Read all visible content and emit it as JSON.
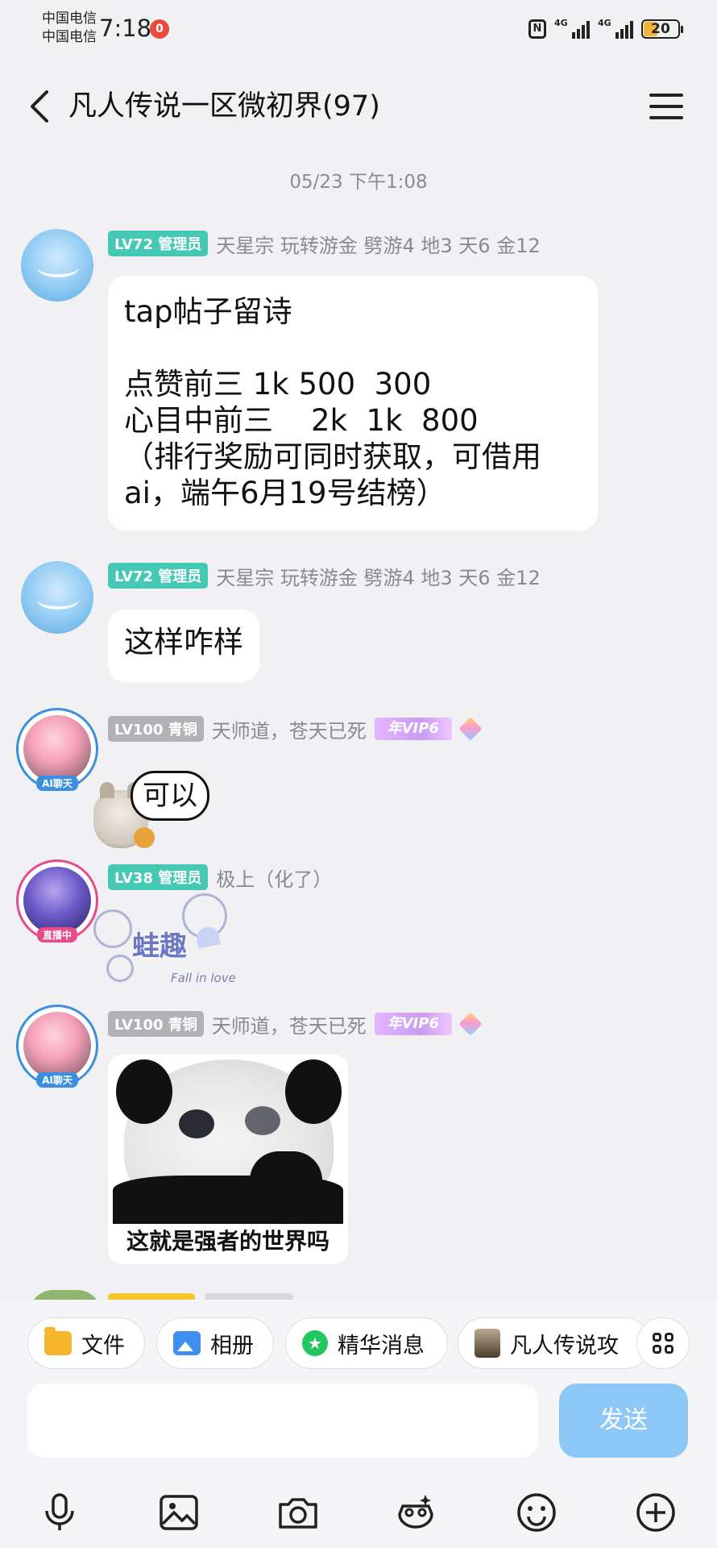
{
  "status_bar": {
    "carrier_1": "中国电信",
    "carrier_2": "中国电信",
    "time": "7:18",
    "notification_count": "0",
    "nfc": "N",
    "network_1": "4G",
    "network_2": "4G",
    "battery": "20"
  },
  "header": {
    "title": "凡人传说一区微初界(97)",
    "back_icon": "chevron-left-icon",
    "menu_icon": "menu-icon"
  },
  "timestamp": "05/23 下午1:08",
  "messages": [
    {
      "badge": "LV72 管理员",
      "name": "天星宗 玩转游金  劈游4 地3  天6 金12",
      "lines": [
        "tap帖子留诗",
        "",
        "点赞前三 1k 500  300",
        "心目中前三    2k  1k  800",
        "（排行奖励可同时获取，可借用",
        "ai，端午6月19号结榜）"
      ]
    },
    {
      "badge": "LV72 管理员",
      "name": "天星宗 玩转游金  劈游4 地3  天6 金12",
      "lines": [
        "这样咋样"
      ]
    },
    {
      "badge": "LV100 青铜",
      "name": "天师道，苍天已死",
      "vip": "年VIP6",
      "avatar_tag": "AI聊天",
      "sticker_text": "可以"
    },
    {
      "badge": "LV38 管理员",
      "name": "极上（化了）",
      "avatar_tag": "直播中",
      "sticker_text": "蛙趣",
      "sticker_sub": "Fall in love"
    },
    {
      "badge": "LV100 青铜",
      "name": "天师道，苍天已死",
      "vip": "年VIP6",
      "avatar_tag": "AI聊天",
      "meme_caption": "这就是强者的世界吗"
    }
  ],
  "quick_actions": [
    {
      "label": "文件",
      "icon": "folder-icon"
    },
    {
      "label": "相册",
      "icon": "album-icon"
    },
    {
      "label": "精华消息",
      "icon": "star-icon"
    },
    {
      "label": "凡人传说攻",
      "icon": "game-icon"
    }
  ],
  "grid_icon": "grid-icon",
  "input": {
    "placeholder": "",
    "send_label": "发送"
  },
  "toolbar": [
    "microphone-icon",
    "image-icon",
    "camera-icon",
    "sticker-icon",
    "emoji-icon",
    "plus-icon"
  ],
  "colors": {
    "background": "#f1f1f4",
    "admin_badge": "#45c9b4",
    "bronze_badge": "#b1b1b6",
    "send_button": "#8ec8f6"
  }
}
